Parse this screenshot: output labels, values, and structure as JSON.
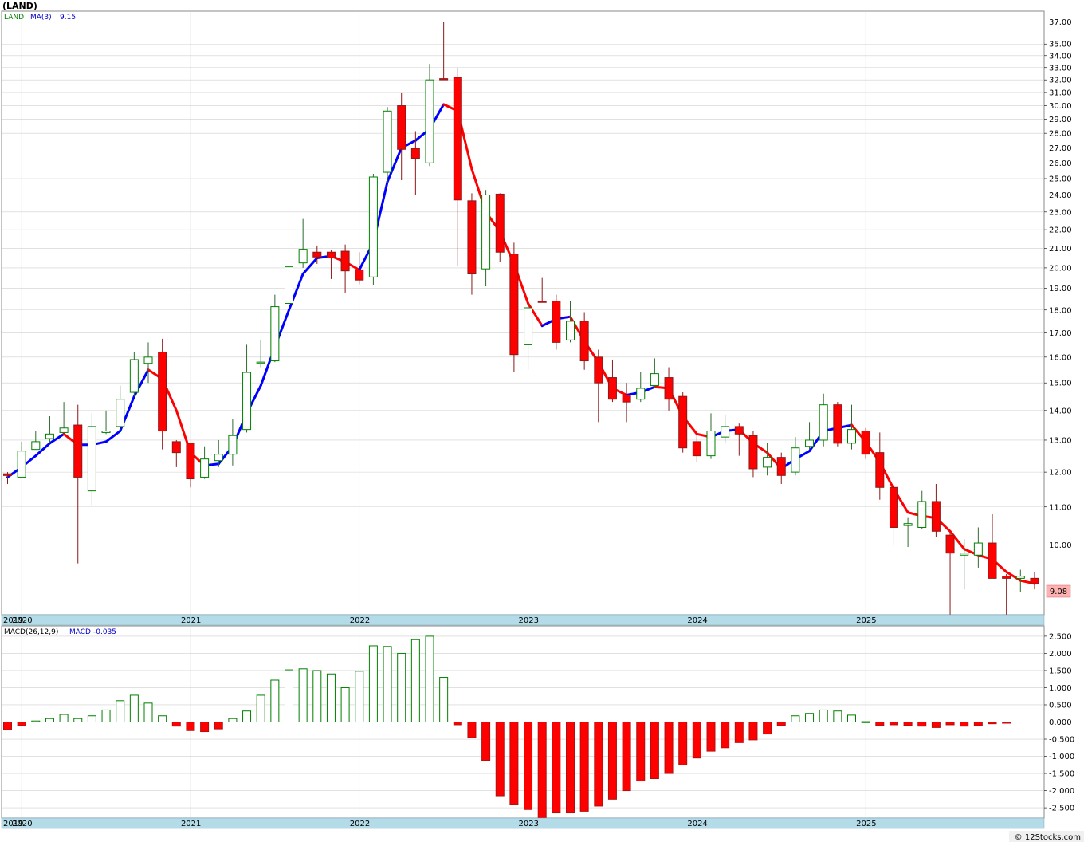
{
  "chart_data": [
    {
      "type": "candlestick",
      "title": "(LAND)",
      "legend": {
        "symbol": "LAND",
        "ma_label": "MA(3)",
        "ma_value": "9.15"
      },
      "last_price_label": "9.08",
      "y_ticks": [
        "37.00",
        "35.00",
        "34.00",
        "33.00",
        "32.00",
        "31.00",
        "30.00",
        "29.00",
        "28.00",
        "27.00",
        "26.00",
        "25.00",
        "24.00",
        "23.00",
        "22.00",
        "21.00",
        "20.00",
        "19.00",
        "18.00",
        "17.00",
        "16.00",
        "15.00",
        "14.00",
        "13.00",
        "12.00",
        "11.00",
        "10.00"
      ],
      "y_scale": "log",
      "ylim": [
        8.4,
        38.0
      ],
      "x_axis_labels": [
        "2019",
        "2020",
        "2021",
        "2022",
        "2023",
        "2024",
        "2025"
      ],
      "candles": [
        {
          "date": "2019-12",
          "o": 11.95,
          "h": 12.0,
          "l": 11.65,
          "c": 11.9
        },
        {
          "date": "2020-01",
          "o": 11.85,
          "h": 12.95,
          "l": 11.85,
          "c": 12.65
        },
        {
          "date": "2020-02",
          "o": 12.7,
          "h": 13.3,
          "l": 12.7,
          "c": 12.95
        },
        {
          "date": "2020-03",
          "o": 13.05,
          "h": 13.8,
          "l": 12.9,
          "c": 13.2
        },
        {
          "date": "2020-04",
          "o": 13.25,
          "h": 14.3,
          "l": 13.25,
          "c": 13.4
        },
        {
          "date": "2020-05",
          "o": 13.5,
          "h": 14.2,
          "l": 9.55,
          "c": 11.85
        },
        {
          "date": "2020-06",
          "o": 11.45,
          "h": 13.9,
          "l": 11.05,
          "c": 13.45
        },
        {
          "date": "2020-07",
          "o": 13.25,
          "h": 14.0,
          "l": 13.2,
          "c": 13.3
        },
        {
          "date": "2020-08",
          "o": 13.45,
          "h": 14.9,
          "l": 13.3,
          "c": 14.4
        },
        {
          "date": "2020-09",
          "o": 14.65,
          "h": 16.2,
          "l": 14.5,
          "c": 15.9
        },
        {
          "date": "2020-10",
          "o": 15.75,
          "h": 16.6,
          "l": 15.0,
          "c": 16.0
        },
        {
          "date": "2020-11",
          "o": 16.2,
          "h": 16.75,
          "l": 12.7,
          "c": 13.3
        },
        {
          "date": "2020-12",
          "o": 12.95,
          "h": 13.0,
          "l": 12.15,
          "c": 12.6
        },
        {
          "date": "2021-01",
          "o": 12.9,
          "h": 12.9,
          "l": 11.55,
          "c": 11.8
        },
        {
          "date": "2021-02",
          "o": 11.85,
          "h": 12.8,
          "l": 11.8,
          "c": 12.4
        },
        {
          "date": "2021-03",
          "o": 12.35,
          "h": 13.0,
          "l": 12.15,
          "c": 12.55
        },
        {
          "date": "2021-04",
          "o": 12.55,
          "h": 13.7,
          "l": 12.2,
          "c": 13.15
        },
        {
          "date": "2021-05",
          "o": 13.35,
          "h": 16.5,
          "l": 13.25,
          "c": 15.4
        },
        {
          "date": "2021-06",
          "o": 15.75,
          "h": 16.7,
          "l": 15.6,
          "c": 15.8
        },
        {
          "date": "2021-07",
          "o": 15.85,
          "h": 18.7,
          "l": 15.8,
          "c": 18.15
        },
        {
          "date": "2021-08",
          "o": 18.3,
          "h": 22.0,
          "l": 17.15,
          "c": 20.05
        },
        {
          "date": "2021-09",
          "o": 20.25,
          "h": 22.6,
          "l": 20.0,
          "c": 20.95
        },
        {
          "date": "2021-10",
          "o": 20.8,
          "h": 21.15,
          "l": 20.2,
          "c": 20.55
        },
        {
          "date": "2021-11",
          "o": 20.8,
          "h": 20.9,
          "l": 19.45,
          "c": 20.5
        },
        {
          "date": "2021-12",
          "o": 20.85,
          "h": 21.2,
          "l": 18.8,
          "c": 19.85
        },
        {
          "date": "2022-01",
          "o": 19.9,
          "h": 20.8,
          "l": 19.2,
          "c": 19.4
        },
        {
          "date": "2022-02",
          "o": 19.55,
          "h": 25.3,
          "l": 19.15,
          "c": 25.1
        },
        {
          "date": "2022-03",
          "o": 25.4,
          "h": 29.9,
          "l": 24.7,
          "c": 29.6
        },
        {
          "date": "2022-04",
          "o": 30.0,
          "h": 30.95,
          "l": 24.9,
          "c": 26.9
        },
        {
          "date": "2022-05",
          "o": 26.95,
          "h": 28.15,
          "l": 24.0,
          "c": 26.3
        },
        {
          "date": "2022-06",
          "o": 26.0,
          "h": 33.3,
          "l": 25.8,
          "c": 32.0
        },
        {
          "date": "2022-07",
          "o": 32.1,
          "h": 37.0,
          "l": 32.0,
          "c": 32.05
        },
        {
          "date": "2022-08",
          "o": 32.2,
          "h": 33.0,
          "l": 20.1,
          "c": 23.7
        },
        {
          "date": "2022-09",
          "o": 23.65,
          "h": 24.1,
          "l": 18.7,
          "c": 19.7
        },
        {
          "date": "2022-10",
          "o": 19.95,
          "h": 24.3,
          "l": 19.1,
          "c": 24.0
        },
        {
          "date": "2022-11",
          "o": 24.05,
          "h": 24.1,
          "l": 20.3,
          "c": 20.8
        },
        {
          "date": "2022-12",
          "o": 20.7,
          "h": 21.3,
          "l": 15.4,
          "c": 16.1
        },
        {
          "date": "2023-01",
          "o": 16.5,
          "h": 18.3,
          "l": 15.5,
          "c": 18.1
        },
        {
          "date": "2023-02",
          "o": 18.4,
          "h": 19.5,
          "l": 18.35,
          "c": 18.35
        },
        {
          "date": "2023-03",
          "o": 18.4,
          "h": 18.7,
          "l": 16.3,
          "c": 16.6
        },
        {
          "date": "2023-04",
          "o": 16.7,
          "h": 18.4,
          "l": 16.6,
          "c": 17.5
        },
        {
          "date": "2023-05",
          "o": 17.5,
          "h": 17.9,
          "l": 15.5,
          "c": 15.85
        },
        {
          "date": "2023-06",
          "o": 16.0,
          "h": 16.3,
          "l": 13.6,
          "c": 15.0
        },
        {
          "date": "2023-07",
          "o": 15.2,
          "h": 15.9,
          "l": 14.3,
          "c": 14.4
        },
        {
          "date": "2023-08",
          "o": 14.55,
          "h": 15.0,
          "l": 13.6,
          "c": 14.3
        },
        {
          "date": "2023-09",
          "o": 14.4,
          "h": 15.4,
          "l": 14.3,
          "c": 14.8
        },
        {
          "date": "2023-10",
          "o": 14.9,
          "h": 15.95,
          "l": 14.8,
          "c": 15.35
        },
        {
          "date": "2023-11",
          "o": 15.2,
          "h": 15.6,
          "l": 14.0,
          "c": 14.4
        },
        {
          "date": "2023-12",
          "o": 14.5,
          "h": 14.65,
          "l": 12.6,
          "c": 12.75
        },
        {
          "date": "2024-01",
          "o": 12.95,
          "h": 13.2,
          "l": 12.3,
          "c": 12.5
        },
        {
          "date": "2024-02",
          "o": 12.5,
          "h": 13.9,
          "l": 12.4,
          "c": 13.3
        },
        {
          "date": "2024-03",
          "o": 13.1,
          "h": 13.85,
          "l": 12.9,
          "c": 13.45
        },
        {
          "date": "2024-04",
          "o": 13.45,
          "h": 13.55,
          "l": 12.5,
          "c": 13.2
        },
        {
          "date": "2024-05",
          "o": 13.15,
          "h": 13.3,
          "l": 11.85,
          "c": 12.1
        },
        {
          "date": "2024-06",
          "o": 12.15,
          "h": 12.9,
          "l": 11.9,
          "c": 12.45
        },
        {
          "date": "2024-07",
          "o": 12.45,
          "h": 12.6,
          "l": 11.65,
          "c": 11.9
        },
        {
          "date": "2024-08",
          "o": 12.0,
          "h": 13.1,
          "l": 11.9,
          "c": 12.75
        },
        {
          "date": "2024-09",
          "o": 12.8,
          "h": 13.6,
          "l": 12.7,
          "c": 13.0
        },
        {
          "date": "2024-10",
          "o": 13.0,
          "h": 14.6,
          "l": 12.8,
          "c": 14.2
        },
        {
          "date": "2024-11",
          "o": 14.2,
          "h": 14.3,
          "l": 12.8,
          "c": 12.9
        },
        {
          "date": "2024-12",
          "o": 12.9,
          "h": 14.2,
          "l": 12.7,
          "c": 13.35
        },
        {
          "date": "2025-01",
          "o": 13.3,
          "h": 13.4,
          "l": 12.4,
          "c": 12.55
        },
        {
          "date": "2025-02",
          "o": 12.6,
          "h": 13.25,
          "l": 11.2,
          "c": 11.55
        },
        {
          "date": "2025-03",
          "o": 11.55,
          "h": 11.6,
          "l": 10.0,
          "c": 10.45
        },
        {
          "date": "2025-04",
          "o": 10.5,
          "h": 10.7,
          "l": 9.95,
          "c": 10.55
        },
        {
          "date": "2025-05",
          "o": 10.45,
          "h": 11.45,
          "l": 10.4,
          "c": 11.15
        },
        {
          "date": "2025-06",
          "o": 11.15,
          "h": 11.65,
          "l": 10.2,
          "c": 10.35
        },
        {
          "date": "2025-07",
          "o": 10.25,
          "h": 10.3,
          "l": 8.4,
          "c": 9.8
        },
        {
          "date": "2025-08",
          "o": 9.75,
          "h": 10.15,
          "l": 8.95,
          "c": 9.8
        },
        {
          "date": "2025-09",
          "o": 9.75,
          "h": 10.45,
          "l": 9.45,
          "c": 10.05
        },
        {
          "date": "2025-10",
          "o": 10.05,
          "h": 10.8,
          "l": 9.2,
          "c": 9.2
        },
        {
          "date": "2025-11",
          "o": 9.25,
          "h": 9.3,
          "l": 8.4,
          "c": 9.2
        },
        {
          "date": "2025-12",
          "o": 9.2,
          "h": 9.4,
          "l": 8.9,
          "c": 9.25
        },
        {
          "date": "2026-01",
          "o": 9.2,
          "h": 9.35,
          "l": 8.95,
          "c": 9.08
        }
      ],
      "ma": [
        11.85,
        12.15,
        12.5,
        12.9,
        13.2,
        12.85,
        12.85,
        12.95,
        13.3,
        14.5,
        15.5,
        15.15,
        14.0,
        12.6,
        12.2,
        12.25,
        12.8,
        13.9,
        14.9,
        16.4,
        18.0,
        19.7,
        20.5,
        20.6,
        20.3,
        19.9,
        21.3,
        24.8,
        27.0,
        27.5,
        28.3,
        30.1,
        29.6,
        25.6,
        23.0,
        21.9,
        20.2,
        18.3,
        17.3,
        17.6,
        17.7,
        16.65,
        15.8,
        14.8,
        14.55,
        14.65,
        14.85,
        14.8,
        13.8,
        13.2,
        13.1,
        13.3,
        13.35,
        12.9,
        12.6,
        12.1,
        12.4,
        12.65,
        13.3,
        13.4,
        13.5,
        12.95,
        12.3,
        11.5,
        10.85,
        10.75,
        10.7,
        10.35,
        9.9,
        9.75,
        9.65,
        9.35,
        9.15,
        9.08
      ],
      "colors": {
        "ma_up": "#0000ff",
        "ma_down": "#ff0000",
        "up_candle": "#008000",
        "down_candle": "#ff0000"
      }
    },
    {
      "type": "bar",
      "title": "MACD(26,12,9)",
      "legend": {
        "macd_label": "MACD:-0.035"
      },
      "y_ticks": [
        "2.500",
        "2.000",
        "1.500",
        "1.000",
        "0.500",
        "0.000",
        "-0.500",
        "-1.000",
        "-1.500",
        "-2.000",
        "-2.500"
      ],
      "ylim": [
        -2.8,
        2.8
      ],
      "x_axis_labels": [
        "2019",
        "2020",
        "2021",
        "2022",
        "2023",
        "2024",
        "2025"
      ],
      "values": [
        -0.22,
        -0.1,
        0.03,
        0.1,
        0.22,
        0.1,
        0.18,
        0.35,
        0.62,
        0.78,
        0.55,
        0.18,
        -0.12,
        -0.25,
        -0.28,
        -0.2,
        0.1,
        0.32,
        0.78,
        1.22,
        1.52,
        1.55,
        1.5,
        1.4,
        1.0,
        1.48,
        2.22,
        2.2,
        2.0,
        2.4,
        2.5,
        1.3,
        -0.08,
        -0.45,
        -1.12,
        -2.15,
        -2.4,
        -2.55,
        -2.8,
        -2.65,
        -2.65,
        -2.6,
        -2.45,
        -2.25,
        -2.0,
        -1.72,
        -1.65,
        -1.5,
        -1.25,
        -1.05,
        -0.85,
        -0.75,
        -0.6,
        -0.52,
        -0.35,
        -0.1,
        0.18,
        0.25,
        0.35,
        0.32,
        0.2,
        0.01,
        -0.1,
        -0.08,
        -0.1,
        -0.12,
        -0.16,
        -0.08,
        -0.12,
        -0.1,
        -0.05,
        -0.035
      ],
      "colors": {
        "positive": "#008000",
        "negative": "#ff0000"
      }
    }
  ],
  "footer": {
    "credit": "© 12Stocks.com"
  }
}
